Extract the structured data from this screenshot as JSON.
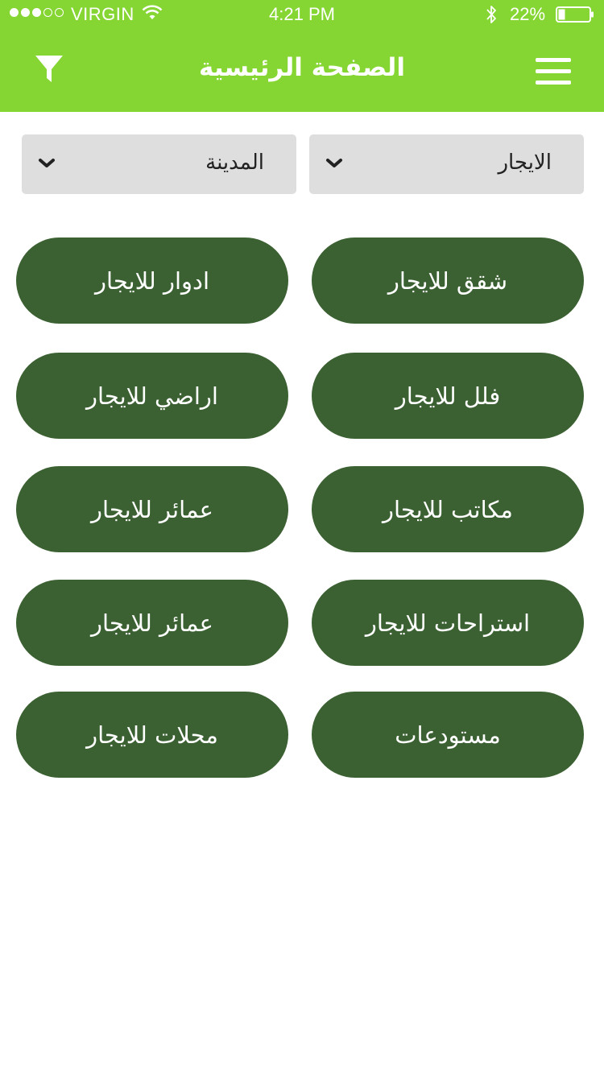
{
  "status_bar": {
    "carrier": "VIRGIN",
    "time": "4:21 PM",
    "battery_percent": "22%",
    "signal_bars_filled": 3,
    "signal_bars_total": 5
  },
  "header": {
    "title": "الصفحة الرئيسية",
    "filter_icon": "filter-icon",
    "menu_icon": "hamburger-menu-icon"
  },
  "filters": {
    "type_select": "الايجار",
    "city_select": "المدينة"
  },
  "categories": [
    "شقق للايجار",
    "ادوار للايجار",
    "فلل للايجار",
    "اراضي للايجار",
    "مكاتب للايجار",
    "عمائر للايجار",
    "استراحات للايجار",
    "عمائر للايجار",
    "مستودعات",
    "محلات للايجار"
  ],
  "colors": {
    "header": "#86d633",
    "button": "#3b6132",
    "select_bg": "#dedede"
  }
}
